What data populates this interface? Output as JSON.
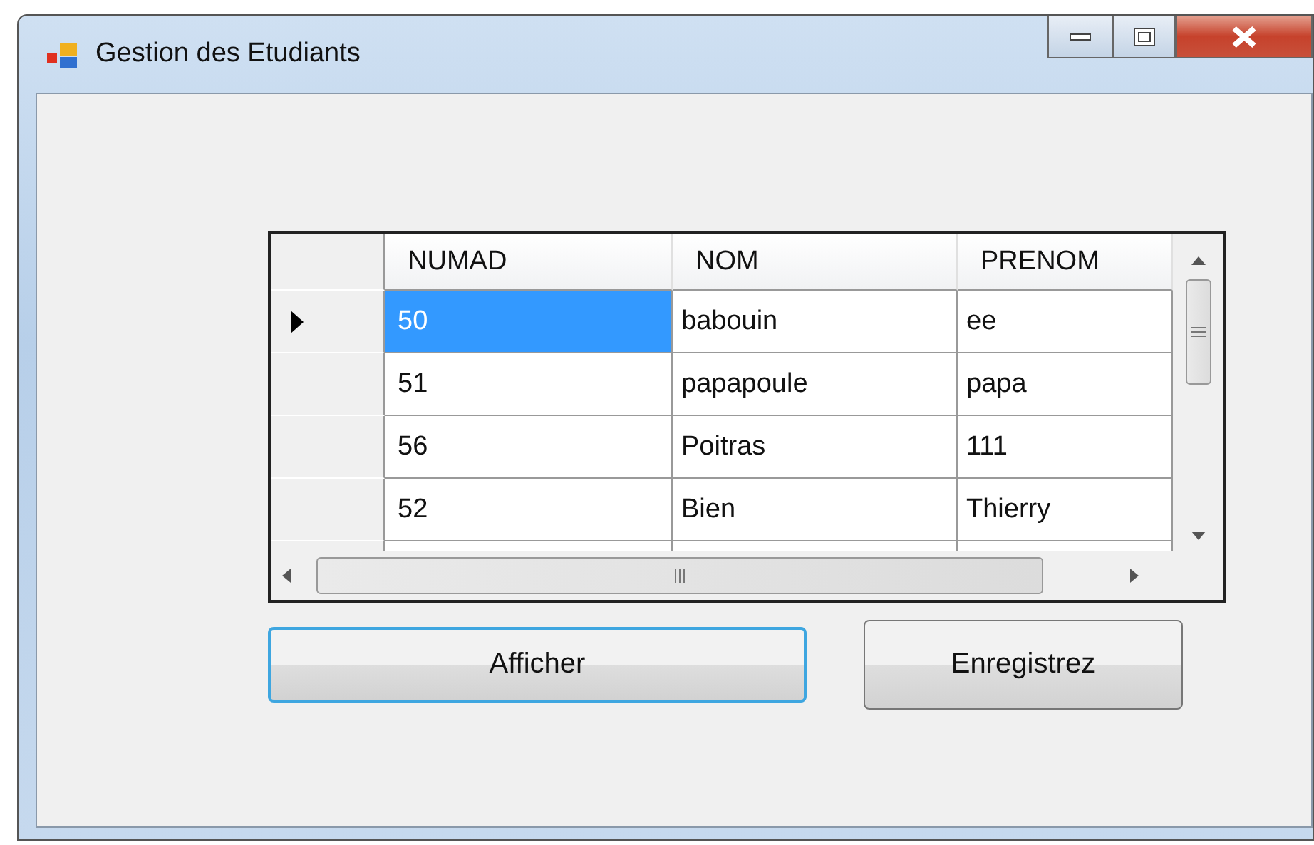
{
  "window": {
    "title": "Gestion des Etudiants"
  },
  "grid": {
    "columns": [
      "NUMAD",
      "NOM",
      "PRENOM"
    ],
    "rows": [
      {
        "current": true,
        "cells": [
          {
            "text": "50",
            "selected": true
          },
          {
            "text": "babouin",
            "selected": false
          },
          {
            "text": "ee",
            "selected": false
          }
        ]
      },
      {
        "current": false,
        "cells": [
          {
            "text": "51",
            "selected": false
          },
          {
            "text": "papapoule",
            "selected": false
          },
          {
            "text": "papa",
            "selected": false
          }
        ]
      },
      {
        "current": false,
        "cells": [
          {
            "text": "56",
            "selected": false
          },
          {
            "text": "Poitras",
            "selected": false
          },
          {
            "text": "111",
            "selected": false
          }
        ]
      },
      {
        "current": false,
        "cells": [
          {
            "text": "52",
            "selected": false
          },
          {
            "text": "Bien",
            "selected": false
          },
          {
            "text": "Thierry",
            "selected": false
          }
        ]
      }
    ]
  },
  "buttons": [
    {
      "label": "Afficher",
      "focused": true
    },
    {
      "label": "Enregistrez",
      "focused": false
    }
  ]
}
